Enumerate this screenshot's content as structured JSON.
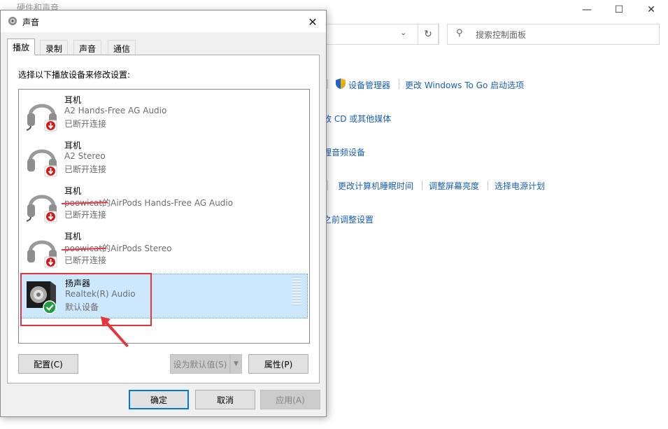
{
  "background_window": {
    "title": "硬件和声音",
    "search_placeholder": "搜索控制面板",
    "links": {
      "device_manager": "设备管理器",
      "windows_to_go": "更改 Windows To Go 启动选项",
      "cd_media": "改 CD 或其他媒体",
      "audio_devices": "理音频设备",
      "sleep_time": "更改计算机睡眠时间",
      "brightness": "调整屏幕亮度",
      "power_plan": "选择电源计划",
      "adjust": "之前调整设置"
    },
    "controls": {
      "minimize": "—",
      "maximize": "☐",
      "close": "✕",
      "dropdown": "⌄",
      "refresh": "↻",
      "search_icon": "⚲"
    }
  },
  "dialog": {
    "title": "声音",
    "close": "✕",
    "tabs": [
      "播放",
      "录制",
      "声音",
      "通信"
    ],
    "instruction": "选择以下播放设备来修改设置:",
    "devices": [
      {
        "name": "耳机",
        "description": "A2 Hands-Free AG Audio",
        "status": "已断开连接",
        "icon": "headset-disconnected-icon"
      },
      {
        "name": "耳机",
        "description": "A2 Stereo",
        "status": "已断开连接",
        "icon": "headset-disconnected-icon"
      },
      {
        "name": "耳机",
        "description": "poowicat的AirPods Hands-Free AG Audio",
        "status": "已断开连接",
        "icon": "headset-disconnected-icon"
      },
      {
        "name": "耳机",
        "description": "poowicat的AirPods Stereo",
        "status": "已断开连接",
        "icon": "headset-disconnected-icon"
      },
      {
        "name": "扬声器",
        "description": "Realtek(R) Audio",
        "status": "默认设备",
        "icon": "speaker-default-icon"
      }
    ],
    "buttons": {
      "configure": "配置(C)",
      "set_default": "设为默认值(S)",
      "set_default_arrow": "▼",
      "properties": "属性(P)",
      "ok": "确定",
      "cancel": "取消",
      "apply": "应用(A)"
    }
  },
  "colors": {
    "link": "#1a5fb4",
    "selection": "#cce8ff",
    "annotation": "#e8333b",
    "default_check": "#1e9e3e",
    "disconnected_arrow": "#d01818"
  }
}
